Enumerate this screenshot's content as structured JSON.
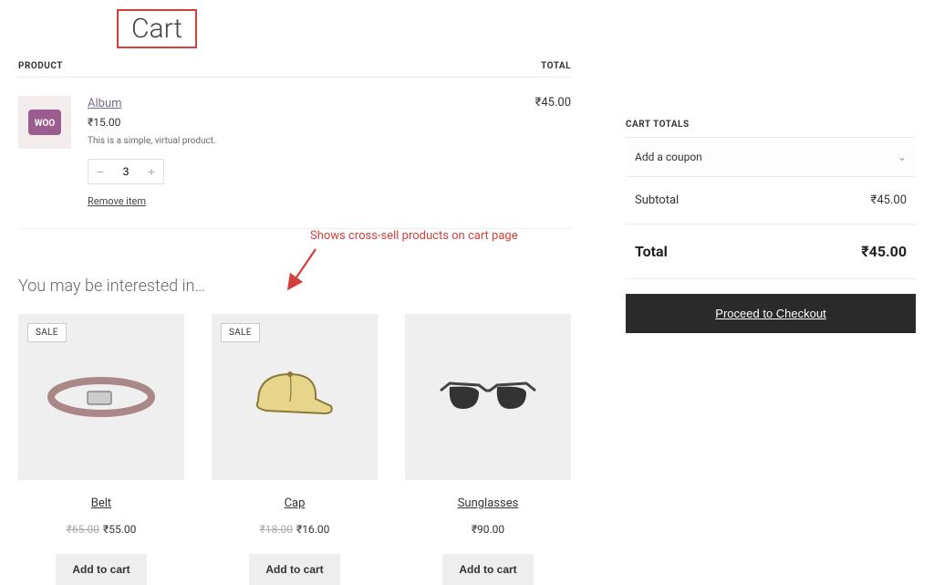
{
  "page_title": "Cart",
  "table": {
    "product_header": "PRODUCT",
    "total_header": "TOTAL"
  },
  "item": {
    "name": "Album",
    "price": "₹15.00",
    "description": "This is a simple, virtual product.",
    "quantity": "3",
    "remove_label": "Remove item",
    "line_total": "₹45.00"
  },
  "annotation": "Shows cross-sell products on cart page",
  "cross_sell_title": "You may be interested in…",
  "products": [
    {
      "name": "Belt",
      "sale": "SALE",
      "original": "₹65.00",
      "price": "₹55.00",
      "cta": "Add to cart"
    },
    {
      "name": "Cap",
      "sale": "SALE",
      "original": "₹18.00",
      "price": "₹16.00",
      "cta": "Add to cart"
    },
    {
      "name": "Sunglasses",
      "sale": "",
      "original": "",
      "price": "₹90.00",
      "cta": "Add to cart"
    }
  ],
  "totals": {
    "heading": "CART TOTALS",
    "coupon_label": "Add a coupon",
    "subtotal_label": "Subtotal",
    "subtotal_value": "₹45.00",
    "total_label": "Total",
    "total_value": "₹45.00",
    "checkout_label": "Proceed to Checkout"
  }
}
